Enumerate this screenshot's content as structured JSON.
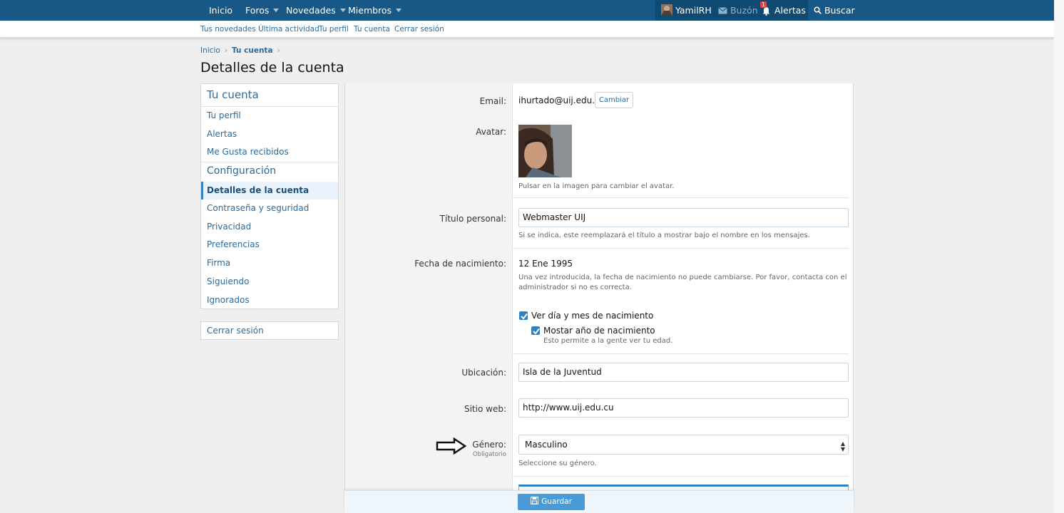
{
  "topnav": {
    "tabs": [
      {
        "label": "Inicio"
      },
      {
        "label": "Foros"
      },
      {
        "label": "Novedades"
      },
      {
        "label": "Miembros"
      }
    ],
    "visitor": {
      "username": "YamilRH",
      "inbox": "Buzón",
      "alerts": "Alertas",
      "alerts_count": "1",
      "search": "Buscar"
    }
  },
  "subnav": {
    "links": [
      "Tus novedades",
      "Última actividad",
      "Tu perfil",
      "Tu cuenta",
      "Cerrar sesión"
    ]
  },
  "breadcrumb": {
    "home": "Inicio",
    "current": "Tu cuenta"
  },
  "page_title": "Detalles de la cuenta",
  "sidebar": {
    "section1": "Tu cuenta",
    "items1": [
      "Tu perfil",
      "Alertas",
      "Me Gusta recibidos"
    ],
    "section2": "Configuración",
    "items2": [
      "Detalles de la cuenta",
      "Contraseña y seguridad",
      "Privacidad",
      "Preferencias",
      "Firma",
      "Siguiendo",
      "Ignorados"
    ],
    "active": "Detalles de la cuenta",
    "logout": "Cerrar sesión"
  },
  "form": {
    "email": {
      "label": "Email:",
      "value": "ihurtado@uij.edu.cu",
      "button": "Cambiar"
    },
    "avatar": {
      "label": "Avatar:",
      "hint": "Pulsar en la imagen para cambiar el avatar."
    },
    "title": {
      "label": "Título personal:",
      "value": "Webmaster UIJ",
      "hint": "Si se indica, este reemplazará el título a mostrar bajo el nombre en los mensajes."
    },
    "birth": {
      "label": "Fecha de nacimiento:",
      "value": "12 Ene 1995",
      "hint1": "Una vez introducida, la fecha de nacimiento no puede cambiarse. Por favor, contacta con el",
      "hint2": "administrador si no es correcta.",
      "check1": "Ver día y mes de nacimiento",
      "check2": "Mostar año de nacimiento",
      "check2_hint": "Esto permite a la gente ver tu edad."
    },
    "location": {
      "label": "Ubicación:",
      "value": "Isla de la Juventud"
    },
    "website": {
      "label": "Sitio web:",
      "value": "http://www.uij.edu.cu"
    },
    "gender": {
      "label": "Género:",
      "required": "Obligatorio",
      "value": "Masculino",
      "hint": "Seleccione su género."
    },
    "save": "Guardar"
  },
  "colors": {
    "topbar": "#185886",
    "link": "#2b6a9b",
    "accent": "#2b83c6",
    "save": "#4a9ad8"
  }
}
